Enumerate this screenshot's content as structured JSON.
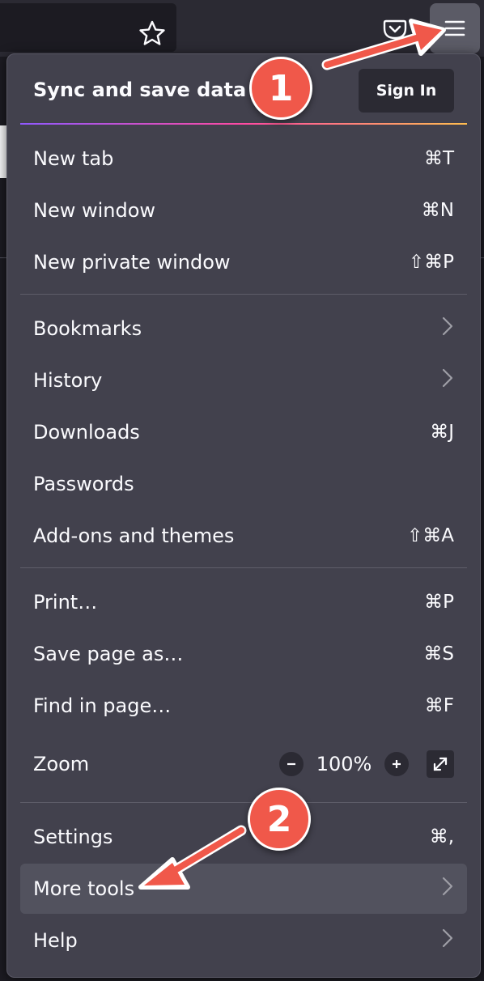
{
  "menu": {
    "sync_title": "Sync and save data",
    "sign_in_label": "Sign In",
    "items": [
      {
        "label": "New tab",
        "shortcut": "⌘T"
      },
      {
        "label": "New window",
        "shortcut": "⌘N"
      },
      {
        "label": "New private window",
        "shortcut": "⇧⌘P"
      },
      {
        "label": "Bookmarks",
        "submenu_icon": "chevron-right-icon"
      },
      {
        "label": "History",
        "submenu_icon": "chevron-right-icon"
      },
      {
        "label": "Downloads",
        "shortcut": "⌘J"
      },
      {
        "label": "Passwords"
      },
      {
        "label": "Add-ons and themes",
        "shortcut": "⇧⌘A"
      },
      {
        "label": "Print…",
        "shortcut": "⌘P"
      },
      {
        "label": "Save page as…",
        "shortcut": "⌘S"
      },
      {
        "label": "Find in page…",
        "shortcut": "⌘F"
      },
      {
        "label": "Settings",
        "shortcut": "⌘,"
      },
      {
        "label": "More tools",
        "submenu_icon": "chevron-right-icon"
      },
      {
        "label": "Help",
        "submenu_icon": "chevron-right-icon"
      }
    ],
    "zoom": {
      "label": "Zoom",
      "value": "100%",
      "minus": "−",
      "plus": "+"
    }
  },
  "annotations": {
    "badge_1": "1",
    "badge_2": "2"
  },
  "colors": {
    "menu_bg": "#42414d",
    "annotation": "#f0584a",
    "hover_bg": "#52525e"
  },
  "icons": [
    "star-icon",
    "pocket-icon",
    "hamburger-menu-icon",
    "fullscreen-icon",
    "chevron-right-icon"
  ]
}
